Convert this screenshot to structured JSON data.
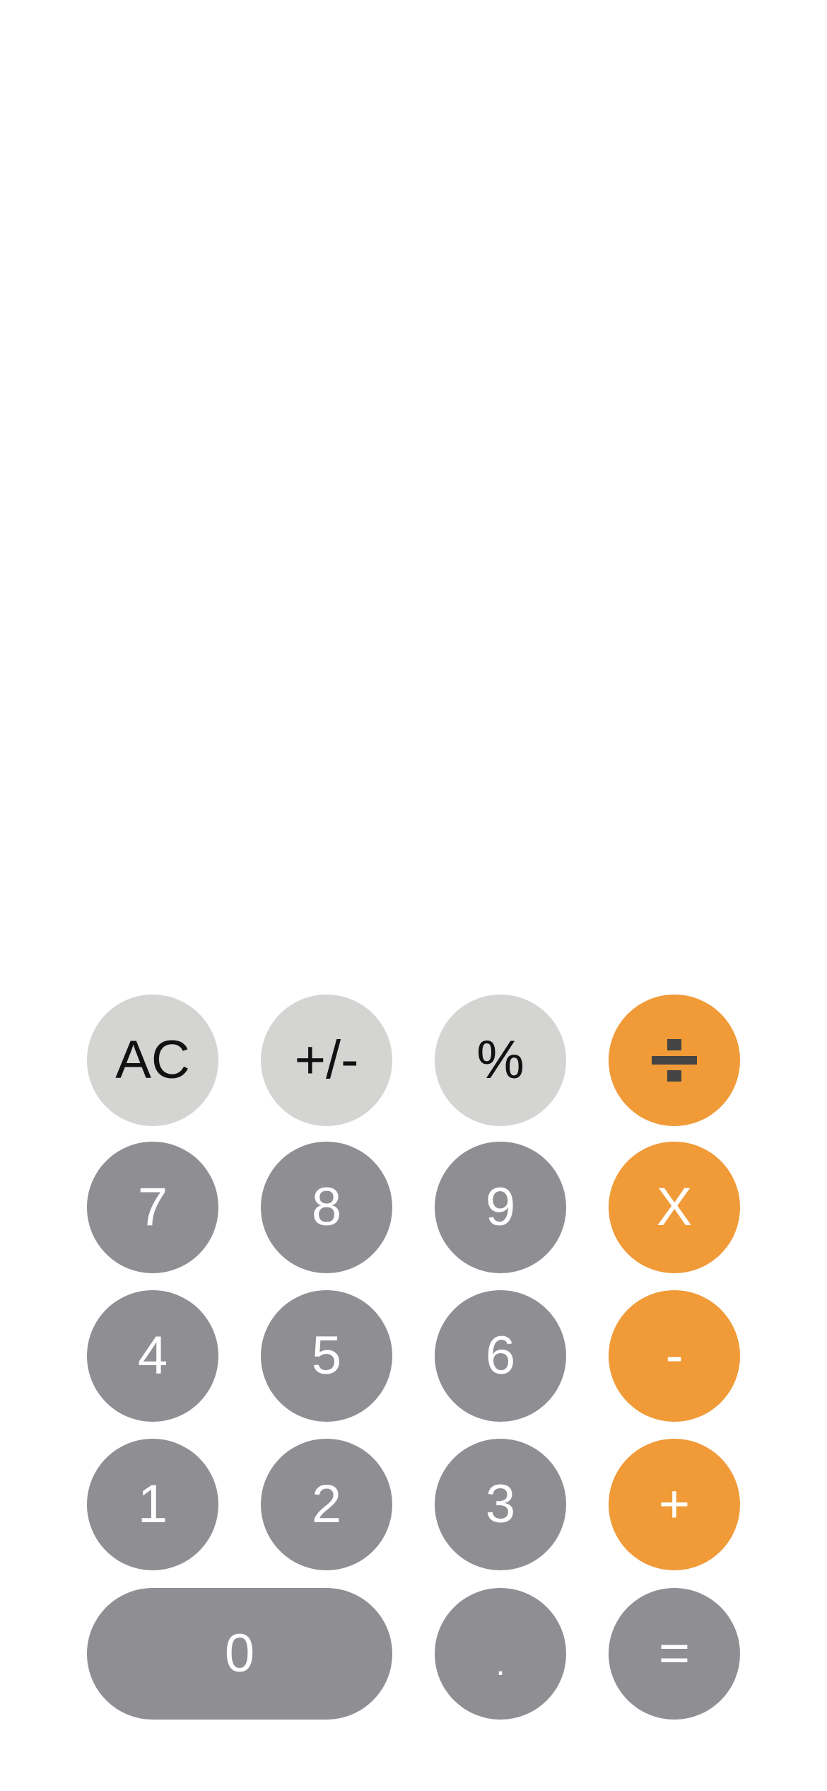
{
  "display": {
    "value": ""
  },
  "keys": {
    "ac": "AC",
    "sign": "+/-",
    "percent": "%",
    "seven": "7",
    "eight": "8",
    "nine": "9",
    "multiply": "X",
    "four": "4",
    "five": "5",
    "six": "6",
    "minus": "-",
    "one": "1",
    "two": "2",
    "three": "3",
    "plus": "+",
    "zero": "0",
    "decimal": ".",
    "equals": "="
  },
  "icons": {
    "divide": "divide-icon"
  },
  "colors": {
    "light_key": "#d4d4d2",
    "dark_key": "#8e8e93",
    "operator_key": "#f09a38",
    "background": "#ffffff"
  }
}
